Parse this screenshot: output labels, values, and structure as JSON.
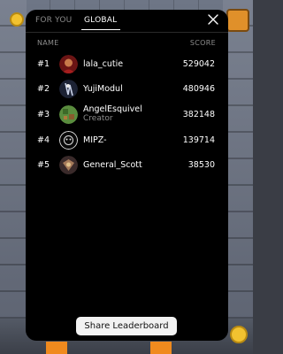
{
  "tabs": [
    {
      "label": "FOR YOU",
      "active": false
    },
    {
      "label": "GLOBAL",
      "active": true
    }
  ],
  "close_icon": "close-icon",
  "columns": {
    "name": "NAME",
    "score": "SCORE"
  },
  "rows": [
    {
      "rank": "#1",
      "name": "lala_cutie",
      "subtitle": "",
      "score": "529042",
      "avatar_color": "#8a1e1e"
    },
    {
      "rank": "#2",
      "name": "YujiModul",
      "subtitle": "",
      "score": "480946",
      "avatar_color": "#2c3550"
    },
    {
      "rank": "#3",
      "name": "AngelEsquivel",
      "subtitle": "Creator",
      "score": "382148",
      "avatar_color": "#4a7a3a"
    },
    {
      "rank": "#4",
      "name": "MIPZ-",
      "subtitle": "",
      "score": "139714",
      "avatar_color": "#111111"
    },
    {
      "rank": "#5",
      "name": "General_Scott",
      "subtitle": "",
      "score": "38530",
      "avatar_color": "#5a3a2a"
    }
  ],
  "share_label": "Share Leaderboard",
  "colors": {
    "modal_bg": "#000000",
    "accent_coin": "#f2c230",
    "chest": "#e0902a"
  }
}
